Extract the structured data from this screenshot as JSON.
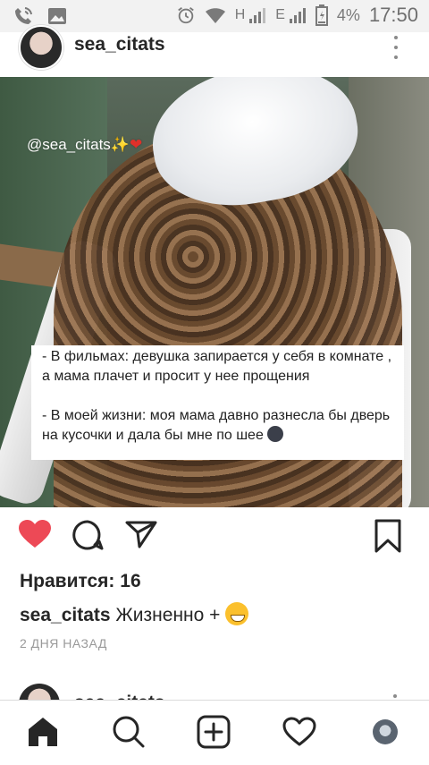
{
  "status_bar": {
    "network_h": "H",
    "network_e": "E",
    "battery_percent": "4%",
    "time": "17:50",
    "icons": [
      "phone-wifi-icon",
      "image-icon",
      "alarm-icon",
      "wifi-icon",
      "signal-icon",
      "battery-icon"
    ]
  },
  "post": {
    "username": "sea_citats",
    "image": {
      "watermark_text": "@sea_citats",
      "card_line1": "- В фильмах: девушка запирается у себя в комнате , а мама плачет и просит у нее прощения",
      "card_line2": "- В моей жизни: моя мама давно разнесла бы дверь на кусочки и дала бы мне по шее"
    },
    "likes_text": "Нравится: 16",
    "caption_user": "sea_citats",
    "caption_text": "Жизненно +",
    "timestamp": "2 ДНЯ НАЗАД",
    "liked": true,
    "like_color": "#ed4956"
  },
  "next_post": {
    "username": "sea_citats"
  },
  "bottom_nav": {
    "items": [
      "home-icon",
      "search-icon",
      "add-post-icon",
      "activity-heart-icon",
      "profile-avatar"
    ]
  }
}
